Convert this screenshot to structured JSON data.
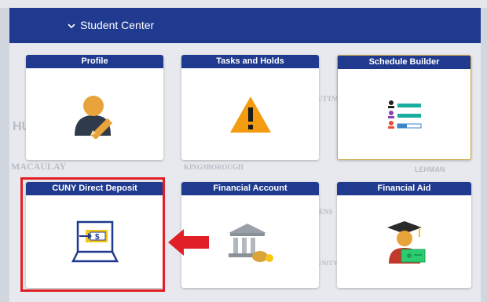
{
  "header": {
    "title": "Student Center",
    "chevron_icon": "chevron-down-icon"
  },
  "tiles": [
    {
      "label": "Profile",
      "icon": "profile-edit-icon"
    },
    {
      "label": "Tasks and Holds",
      "icon": "warning-icon"
    },
    {
      "label": "Schedule Builder",
      "icon": "schedule-list-icon"
    },
    {
      "label": "CUNY Direct Deposit",
      "icon": "direct-deposit-laptop-icon"
    },
    {
      "label": "Financial Account",
      "icon": "bank-money-icon"
    },
    {
      "label": "Financial Aid",
      "icon": "graduate-payment-icon"
    }
  ],
  "annotation": {
    "highlight_color": "#e02026",
    "arrow_color": "#e02026",
    "target": "CUNY Direct Deposit"
  },
  "colors": {
    "header_bg": "#1f3a8e",
    "page_bg": "#e7e9ee"
  },
  "background_watermarks": [
    "MACAULAY",
    "KINGSBOROUGH",
    "LEHMAN",
    "HU",
    "UTTM",
    "ENS",
    "UNITY"
  ]
}
